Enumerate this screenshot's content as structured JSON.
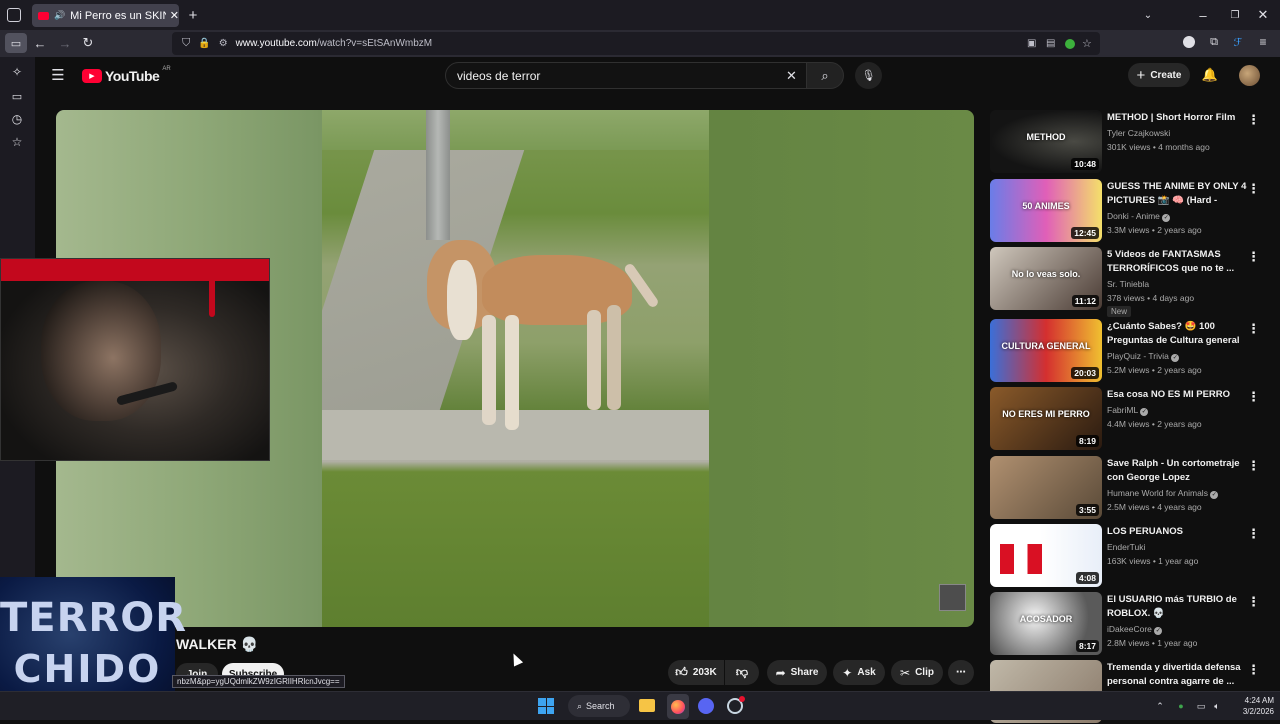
{
  "browser": {
    "tab_title": "Mi Perro es un SKINWALKER",
    "url_host": "www.youtube.com",
    "url_path": "/watch?v=sEtSAnWmbzM",
    "status_url": "nbzM&pp=ygUQdmlkZW9zIGRlIHRlcnJvcg=="
  },
  "youtube": {
    "logo": "YouTube",
    "country": "AR",
    "search_value": "videos de terror",
    "create_label": "Create"
  },
  "video": {
    "title_visible": "WALKER 💀",
    "join_label": "Join",
    "subscribe_label": "Subscribe",
    "likes": "203K",
    "share_label": "Share",
    "ask_label": "Ask",
    "clip_label": "Clip"
  },
  "overlay": {
    "line1": "TERROR",
    "line2": "CHIDO"
  },
  "recommendations": [
    {
      "title": "METHOD | Short Horror Film",
      "channel": "Tyler Czajkowski",
      "meta": "301K views • 4 months ago",
      "duration": "10:48",
      "verified": false,
      "thumb_text": "METHOD"
    },
    {
      "title": "GUESS THE ANIME BY ONLY 4 PICTURES 📸 🧠 (Hard - Supe...",
      "channel": "Donki - Anime",
      "meta": "3.3M views • 2 years ago",
      "duration": "12:45",
      "verified": true,
      "thumb_text": "50 ANIMES"
    },
    {
      "title": "5 Videos de FANTASMAS TERRORÍFICOS que no te ...",
      "channel": "Sr. Tiniebla",
      "meta": "378 views • 4 days ago",
      "duration": "11:12",
      "verified": false,
      "badge": "New",
      "thumb_text": "No lo veas solo."
    },
    {
      "title": "¿Cuánto Sabes? 🤩 100 Preguntas de Cultura general ...",
      "channel": "PlayQuiz - Trivia",
      "meta": "5.2M views • 2 years ago",
      "duration": "20:03",
      "verified": true,
      "thumb_text": "CULTURA GENERAL"
    },
    {
      "title": "Esa cosa NO ES MI PERRO",
      "channel": "FabriML",
      "meta": "4.4M views • 2 years ago",
      "duration": "8:19",
      "verified": true,
      "thumb_text": "NO ERES MI PERRO"
    },
    {
      "title": "Save Ralph - Un cortometraje con George Lopez",
      "channel": "Humane World for Animals",
      "meta": "2.5M views • 4 years ago",
      "duration": "3:55",
      "verified": true,
      "thumb_text": ""
    },
    {
      "title": "LOS PERUANOS",
      "channel": "EnderTuki",
      "meta": "163K views • 1 year ago",
      "duration": "4:08",
      "verified": false,
      "thumb_text": ""
    },
    {
      "title": "El USUARIO más TURBIO de ROBLOX. 💀",
      "channel": "iDakeeCore",
      "meta": "2.8M views • 1 year ago",
      "duration": "8:17",
      "verified": true,
      "thumb_text": "ACOSADOR"
    },
    {
      "title": "Tremenda y divertida defensa personal contra agarre de ...",
      "channel": "",
      "meta": "",
      "duration": "",
      "verified": false,
      "thumb_text": ""
    }
  ],
  "taskbar": {
    "search_label": "Search",
    "time": "4:24 AM",
    "date": "3/2/2026"
  },
  "colors": {
    "youtube_red": "#ff0033",
    "bg": "#0f0f0f"
  }
}
